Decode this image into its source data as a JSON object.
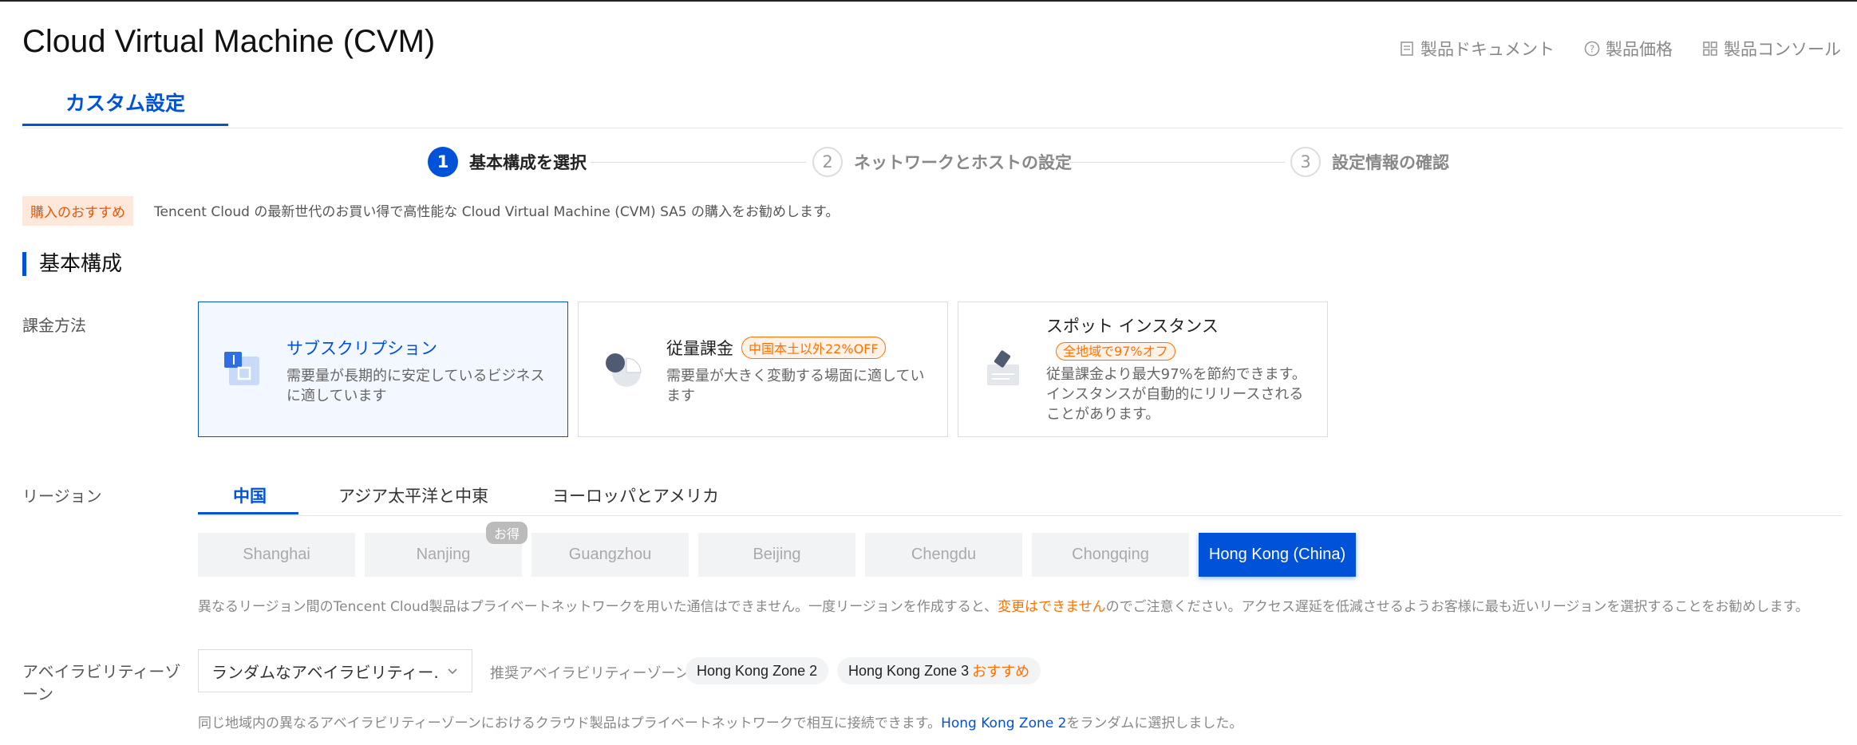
{
  "header": {
    "title": "Cloud Virtual Machine (CVM)",
    "links": [
      {
        "label": "製品ドキュメント",
        "icon": "document-icon"
      },
      {
        "label": "製品価格",
        "icon": "question-circle-icon"
      },
      {
        "label": "製品コンソール",
        "icon": "grid-icon"
      }
    ]
  },
  "tabs": {
    "active": "カスタム設定"
  },
  "stepper": {
    "steps": [
      {
        "num": "1",
        "label": "基本構成を選択",
        "active": true
      },
      {
        "num": "2",
        "label": "ネットワークとホストの設定",
        "active": false
      },
      {
        "num": "3",
        "label": "設定情報の確認",
        "active": false
      }
    ]
  },
  "recommendation": {
    "badge": "購入のおすすめ",
    "text": "Tencent Cloud の最新世代のお買い得で高性能な Cloud Virtual Machine (CVM) SA5 の購入をお勧めします。"
  },
  "section": {
    "title": "基本構成"
  },
  "billing": {
    "label": "課金方法",
    "cards": [
      {
        "title": "サブスクリプション",
        "promo": "",
        "desc": "需要量が長期的に安定しているビジネスに適しています",
        "selected": true
      },
      {
        "title": "従量課金",
        "promo": "中国本土以外22%OFF",
        "desc": "需要量が大きく変動する場面に適しています",
        "selected": false
      },
      {
        "title": "スポット インスタンス",
        "promo": "全地域で97%オフ",
        "desc": "従量課金より最大97%を節約できます。インスタンスが自動的にリリースされることがあります。",
        "selected": false
      }
    ]
  },
  "region": {
    "label": "リージョン",
    "tabs": [
      "中国",
      "アジア太平洋と中東",
      "ヨーロッパとアメリカ"
    ],
    "cities": [
      "Shanghai",
      "Nanjing",
      "Guangzhou",
      "Beijing",
      "Chengdu",
      "Chongqing",
      "Hong Kong (China)"
    ],
    "selected_city": "Hong Kong (China)",
    "deal_badge": "お得",
    "note_before": "異なるリージョン間のTencent Cloud製品はプライベートネットワークを用いた通信はできません。一度リージョンを作成すると、",
    "note_warn": "変更はできません",
    "note_after": "のでご注意ください。アクセス遅延を低減させるようお客様に最も近いリージョンを選択することをお勧めします。"
  },
  "availability_zone": {
    "label_line1": "アベイラビリティーゾ",
    "label_line2": "ーン",
    "select_value": "ランダムなアベイラビリティー...",
    "recommended_label": "推奨アベイラビリティーゾーン",
    "zones": [
      {
        "name": "Hong Kong Zone 2",
        "tag": ""
      },
      {
        "name": "Hong Kong Zone 3",
        "tag": "おすすめ"
      }
    ],
    "note_before": "同じ地域内の異なるアベイラビリティーゾーンにおけるクラウド製品はプライベートネットワークで相互に接続できます。",
    "note_link": "Hong Kong Zone 2",
    "note_after": "をランダムに選択しました。"
  },
  "colors": {
    "accent": "#0052d9",
    "warning": "#ff7200"
  }
}
